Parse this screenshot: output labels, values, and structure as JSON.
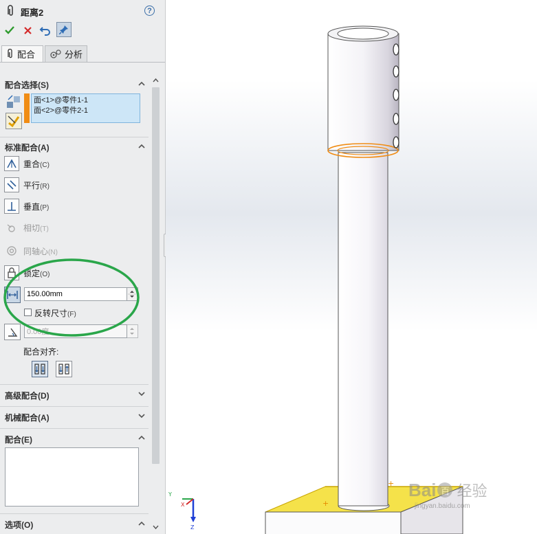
{
  "panel": {
    "title": "距离2",
    "help_icon": "?",
    "tabs": [
      {
        "label": "配合"
      },
      {
        "label": "分析"
      }
    ],
    "mate_selection": {
      "title": "配合选择(S)",
      "entities": [
        "面<1>@零件1-1",
        "面<2>@零件2-1"
      ]
    },
    "standard_mates": {
      "title": "标准配合(A)",
      "items": [
        {
          "label": "重合",
          "shortcut": "(C)",
          "enabled": true
        },
        {
          "label": "平行",
          "shortcut": "(R)",
          "enabled": true
        },
        {
          "label": "垂直",
          "shortcut": "(P)",
          "enabled": true
        },
        {
          "label": "相切",
          "shortcut": "(T)",
          "enabled": false
        },
        {
          "label": "同轴心",
          "shortcut": "(N)",
          "enabled": false
        },
        {
          "label": "锁定",
          "shortcut": "(O)",
          "enabled": true
        }
      ],
      "distance_value": "150.00mm",
      "flip_label": "反转尺寸",
      "flip_shortcut": "(F)",
      "angle_value": "0.00度",
      "alignment_label": "配合对齐:"
    },
    "advanced_title": "高级配合(D)",
    "mechanical_title": "机械配合(A)",
    "mates_title": "配合(E)",
    "options_title": "选项(O)"
  },
  "colors": {
    "accent_orange": "#f08c14",
    "selection_blue": "#cde6f7",
    "annotation_green": "#2aa64a",
    "face_yellow": "#f5e24a"
  },
  "watermark": {
    "brand": "Bai",
    "brand2": "百",
    "site_cn": "经验",
    "site_url": "jingyan.baidu.com"
  }
}
